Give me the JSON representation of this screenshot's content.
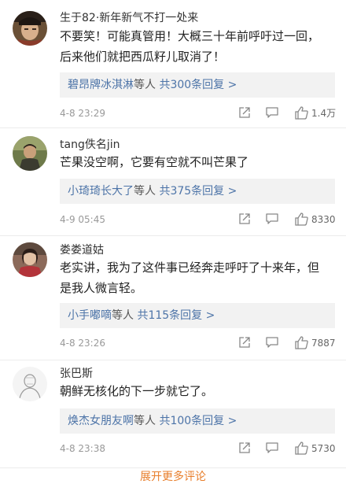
{
  "comments": [
    {
      "username": "生于82·新年新气不打一处来",
      "text_lines": [
        "不要笑！可能真管用！大概三十年前呼吁过一回，",
        "后来他们就把西瓜籽儿取消了！"
      ],
      "reply_user": "碧昂牌冰淇淋",
      "reply_mid": "等人",
      "reply_count": "共300条回复 >",
      "time": "4-8 23:29",
      "likes": "1.4万",
      "avatar_icon": "avatar-costume-man-icon"
    },
    {
      "username": "tang佚名jin",
      "text_lines": [
        "芒果没空啊，它要有空就不叫芒果了"
      ],
      "reply_user": "小琦琦长大了",
      "reply_mid": "等人",
      "reply_count": "共375条回复 >",
      "time": "4-9 05:45",
      "likes": "8330",
      "avatar_icon": "avatar-man-outdoor-icon"
    },
    {
      "username": "娄娄道姑",
      "text_lines": [
        "老实讲，我为了这件事已经奔走呼吁了十来年，但",
        "是我人微言轻。"
      ],
      "reply_user": "小手嘟嘀",
      "reply_mid": "等人",
      "reply_count": "共115条回复 >",
      "time": "4-8 23:26",
      "likes": "7887",
      "avatar_icon": "avatar-woman-red-icon"
    },
    {
      "username": "张巴斯",
      "text_lines": [
        "朝鲜无核化的下一步就它了。"
      ],
      "reply_user": "焕杰女朋友啊",
      "reply_mid": "等人",
      "reply_count": "共100条回复 >",
      "time": "4-8 23:38",
      "likes": "5730",
      "avatar_icon": "avatar-sketch-icon"
    }
  ],
  "expand_more": "展开更多评论",
  "colors": {
    "link": "#4d74a8",
    "meta": "#999999",
    "expand": "#e87e2b",
    "reply_bg": "#f2f2f2"
  }
}
